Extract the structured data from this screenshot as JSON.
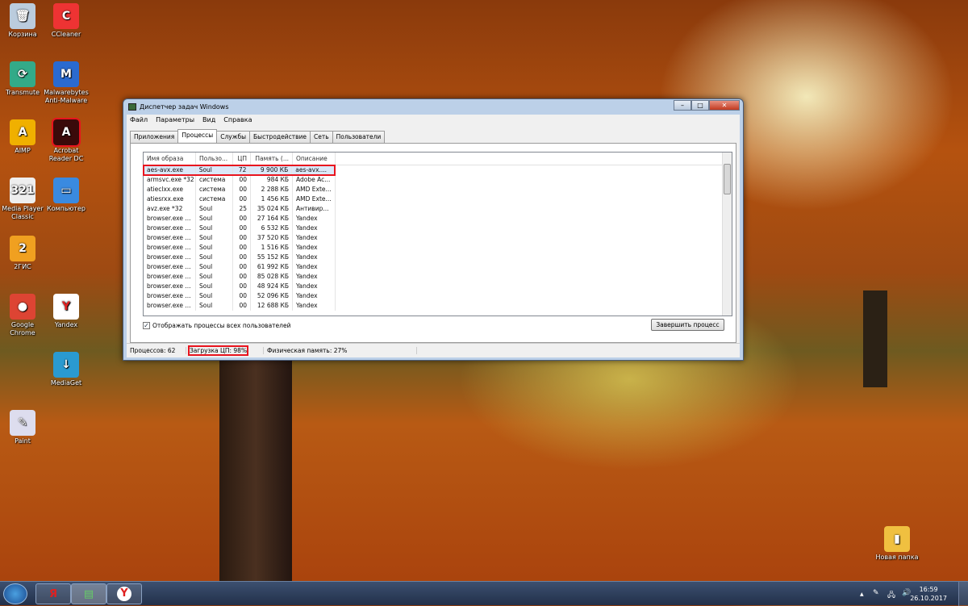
{
  "desktop": {
    "icons": [
      {
        "label": "Корзина",
        "glyph": "🗑",
        "color": "#bcd"
      },
      {
        "label": "CCleaner",
        "glyph": "C",
        "color": "#e33"
      },
      {
        "label": "Transmute",
        "glyph": "⟳",
        "color": "#3a8"
      },
      {
        "label": "Malwarebytes Anti-Malware",
        "glyph": "M",
        "color": "#2a6ad0"
      },
      {
        "label": "AIMP",
        "glyph": "A",
        "color": "#f0b000"
      },
      {
        "label": "Acrobat Reader DC",
        "glyph": "A",
        "color": "#3a0a0a"
      },
      {
        "label": "Media Player Classic",
        "glyph": "321",
        "color": "#eee"
      },
      {
        "label": "Компьютер",
        "glyph": "▭",
        "color": "#3a8ae0"
      },
      {
        "label": "2ГИС",
        "glyph": "2",
        "color": "#f0a020"
      },
      {
        "label": "Google Chrome",
        "glyph": "●",
        "color": "#dd4433"
      },
      {
        "label": "Yandex",
        "glyph": "Y",
        "color": "#fff"
      },
      {
        "label": "MediaGet",
        "glyph": "↓",
        "color": "#2a9ad0"
      },
      {
        "label": "Paint",
        "glyph": "✎",
        "color": "#dde"
      },
      {
        "label": "Новая папка",
        "glyph": "▮",
        "color": "#f0c040"
      }
    ]
  },
  "window": {
    "title": "Диспетчер задач Windows",
    "controls": {
      "minimize": "–",
      "maximize": "□",
      "close": "✕"
    },
    "menu": [
      "Файл",
      "Параметры",
      "Вид",
      "Справка"
    ],
    "tabs": [
      "Приложения",
      "Процессы",
      "Службы",
      "Быстродействие",
      "Сеть",
      "Пользователи"
    ],
    "active_tab": "Процессы",
    "columns": [
      "Имя образа",
      "Пользо...",
      "ЦП",
      "Память (...",
      "Описание"
    ],
    "rows": [
      [
        "aes-avx.exe",
        "Soul",
        "72",
        "9 900 КБ",
        "aes-avx...."
      ],
      [
        "armsvc.exe *32",
        "система",
        "00",
        "984 КБ",
        "Adobe Ac..."
      ],
      [
        "atieclxx.exe",
        "система",
        "00",
        "2 288 КБ",
        "AMD Exte..."
      ],
      [
        "atiesrxx.exe",
        "система",
        "00",
        "1 456 КБ",
        "AMD Exte..."
      ],
      [
        "avz.exe *32",
        "Soul",
        "25",
        "35 024 КБ",
        "Антивир..."
      ],
      [
        "browser.exe ...",
        "Soul",
        "00",
        "27 164 КБ",
        "Yandex"
      ],
      [
        "browser.exe ...",
        "Soul",
        "00",
        "6 532 КБ",
        "Yandex"
      ],
      [
        "browser.exe ...",
        "Soul",
        "00",
        "37 520 КБ",
        "Yandex"
      ],
      [
        "browser.exe ...",
        "Soul",
        "00",
        "1 516 КБ",
        "Yandex"
      ],
      [
        "browser.exe ...",
        "Soul",
        "00",
        "55 152 КБ",
        "Yandex"
      ],
      [
        "browser.exe ...",
        "Soul",
        "00",
        "61 992 КБ",
        "Yandex"
      ],
      [
        "browser.exe ...",
        "Soul",
        "00",
        "85 028 КБ",
        "Yandex"
      ],
      [
        "browser.exe ...",
        "Soul",
        "00",
        "48 924 КБ",
        "Yandex"
      ],
      [
        "browser.exe ...",
        "Soul",
        "00",
        "52 096 КБ",
        "Yandex"
      ],
      [
        "browser.exe ...",
        "Soul",
        "00",
        "12 688 КБ",
        "Yandex"
      ]
    ],
    "show_all_label": "Отображать процессы всех пользователей",
    "show_all_checked": true,
    "end_process_label": "Завершить процесс",
    "status": {
      "processes": "Процессов: 62",
      "cpu": "Загрузка ЦП: 98%",
      "memory": "Физическая память: 27%"
    }
  },
  "taskbar": {
    "buttons": [
      {
        "glyph": "Я",
        "color": "#e02020"
      },
      {
        "glyph": "▤",
        "color": "#6c6"
      },
      {
        "glyph": "Y",
        "color": "#e02020"
      }
    ],
    "time": "16:59",
    "date": "26.10.2017",
    "tray": [
      "▲",
      "✎",
      "🖧",
      "🔊"
    ]
  },
  "highlight_color": "#e8141e"
}
